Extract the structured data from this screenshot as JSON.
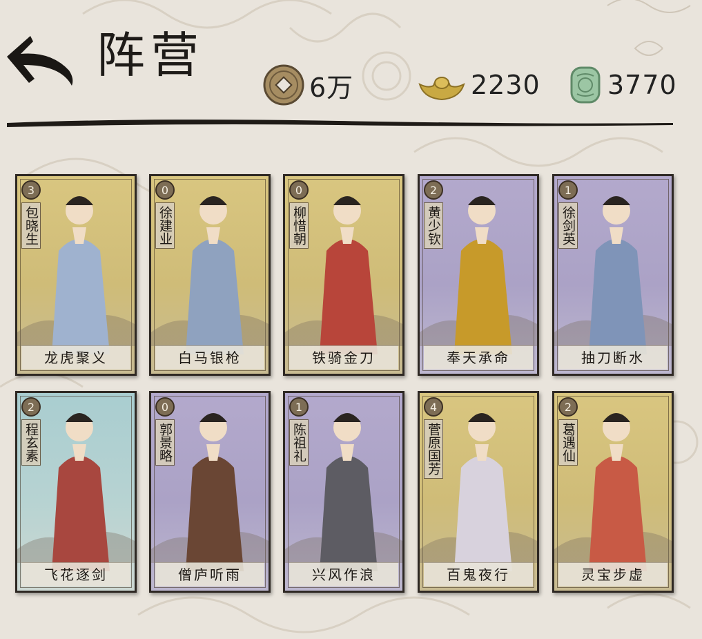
{
  "header": {
    "title": "阵营",
    "back_icon": "back-arrow-icon"
  },
  "currencies": [
    {
      "icon": "copper-coin-icon",
      "value": "6万"
    },
    {
      "icon": "gold-ingot-icon",
      "value": "2230"
    },
    {
      "icon": "jade-token-icon",
      "value": "3770"
    }
  ],
  "colors": {
    "background": "#e9e4dc",
    "card_gold": "#d9c680",
    "card_purple": "#b3a9cc",
    "card_teal": "#a9cdd0"
  },
  "cards": [
    {
      "count": "3",
      "name": "包晓生",
      "skill": "龙虎聚义",
      "bg": "gold",
      "robe": "#9fb2cf"
    },
    {
      "count": "0",
      "name": "徐建业",
      "skill": "白马银枪",
      "bg": "gold",
      "robe": "#8fa2bf"
    },
    {
      "count": "0",
      "name": "柳惜朝",
      "skill": "铁骑金刀",
      "bg": "gold",
      "robe": "#b8453a"
    },
    {
      "count": "2",
      "name": "黄少钦",
      "skill": "奉天承命",
      "bg": "purple",
      "robe": "#c79a2a"
    },
    {
      "count": "1",
      "name": "徐剑英",
      "skill": "抽刀断水",
      "bg": "purple",
      "robe": "#7f94b8"
    },
    {
      "count": "2",
      "name": "程玄素",
      "skill": "飞花逐剑",
      "bg": "teal",
      "robe": "#a8473f"
    },
    {
      "count": "0",
      "name": "郭景略",
      "skill": "僧庐听雨",
      "bg": "purple",
      "robe": "#6a4634"
    },
    {
      "count": "1",
      "name": "陈祖礼",
      "skill": "兴风作浪",
      "bg": "purple",
      "robe": "#5d5c63"
    },
    {
      "count": "4",
      "name": "菅原国芳",
      "skill": "百鬼夜行",
      "bg": "gold",
      "robe": "#d8d2dd"
    },
    {
      "count": "2",
      "name": "葛遇仙",
      "skill": "灵宝步虚",
      "bg": "gold",
      "robe": "#c85a45"
    }
  ]
}
